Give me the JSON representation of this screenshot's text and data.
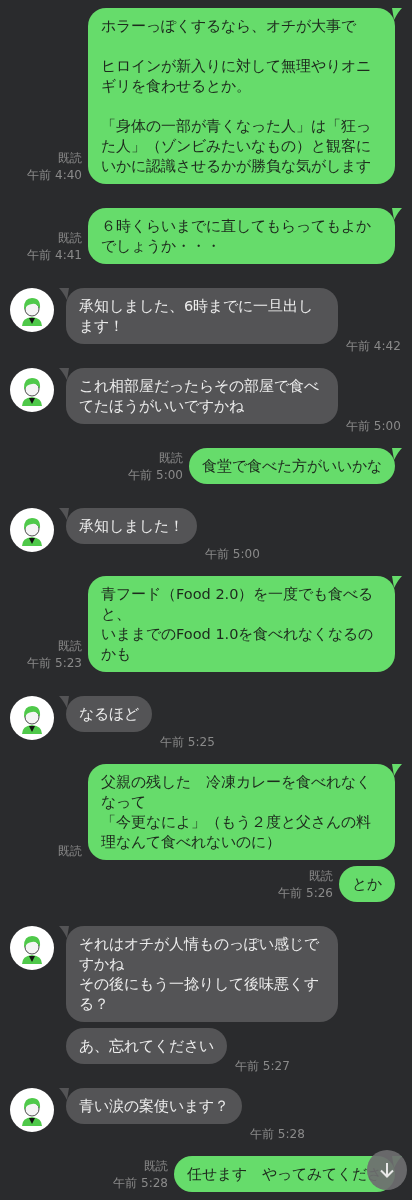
{
  "messages": [
    {
      "kind": "sent",
      "spaced": true,
      "lines": [
        "ホラーっぽくするなら、オチが大事で",
        "ヒロインが新入りに対して無理やりオニギリを食わせるとか。",
        "「身体の一部が青くなった人」は「狂った人」（ゾンビみたいなもの）と観客にいかに認識させるかが勝負な気がします"
      ],
      "read": "既読",
      "time": "午前 4:40"
    },
    {
      "kind": "sent",
      "lines": [
        "６時くらいまでに直してもらってもよかでしょうか・・・"
      ],
      "read": "既読",
      "time": "午前 4:41"
    },
    {
      "kind": "received",
      "avatar": true,
      "lines": [
        "承知しました、6時までに一旦出します！"
      ],
      "time": "午前 4:42"
    },
    {
      "kind": "received",
      "avatar": true,
      "lines": [
        "これ相部屋だったらその部屋で食べてたほうがいいですかね"
      ],
      "time": "午前 5:00"
    },
    {
      "kind": "sent",
      "lines": [
        "食堂で食べた方がいいかな"
      ],
      "read": "既読",
      "time": "午前 5:00"
    },
    {
      "kind": "received",
      "avatar": true,
      "lines": [
        "承知しました！"
      ],
      "time": "午前 5:00"
    },
    {
      "kind": "sent",
      "spaced": false,
      "lines": [
        "青フード（Food 2.0）を一度でも食べると、",
        "いままでのFood 1.0を食べれなくなるのかも"
      ],
      "read": "既読",
      "time": "午前 5:23"
    },
    {
      "kind": "received",
      "avatar": true,
      "lines": [
        "なるほど"
      ],
      "time": "午前 5:25"
    },
    {
      "kind": "sent",
      "spaced": false,
      "lines": [
        "父親の残した　冷凍カレーを食べれなくなって",
        "「今更なによ」（もう２度と父さんの料理なんて食べれないのに）"
      ],
      "read": "既読"
    },
    {
      "kind": "sent",
      "lines": [
        "とか"
      ],
      "read": "既読",
      "time": "午前 5:26"
    },
    {
      "kind": "received",
      "avatar": true,
      "lines": [
        "それはオチが人情ものっぽい感じですかね",
        "その後にもう一捻りして後味悪くする？"
      ]
    },
    {
      "kind": "received",
      "avatar": false,
      "lines": [
        "あ、忘れてください"
      ],
      "time": "午前 5:27"
    },
    {
      "kind": "received",
      "avatar": true,
      "lines": [
        "青い涙の案使います？"
      ],
      "time": "午前 5:28"
    },
    {
      "kind": "sent",
      "lines": [
        "任せます　やってみてくださ"
      ],
      "read": "既読",
      "time": "午前 5:28"
    }
  ]
}
